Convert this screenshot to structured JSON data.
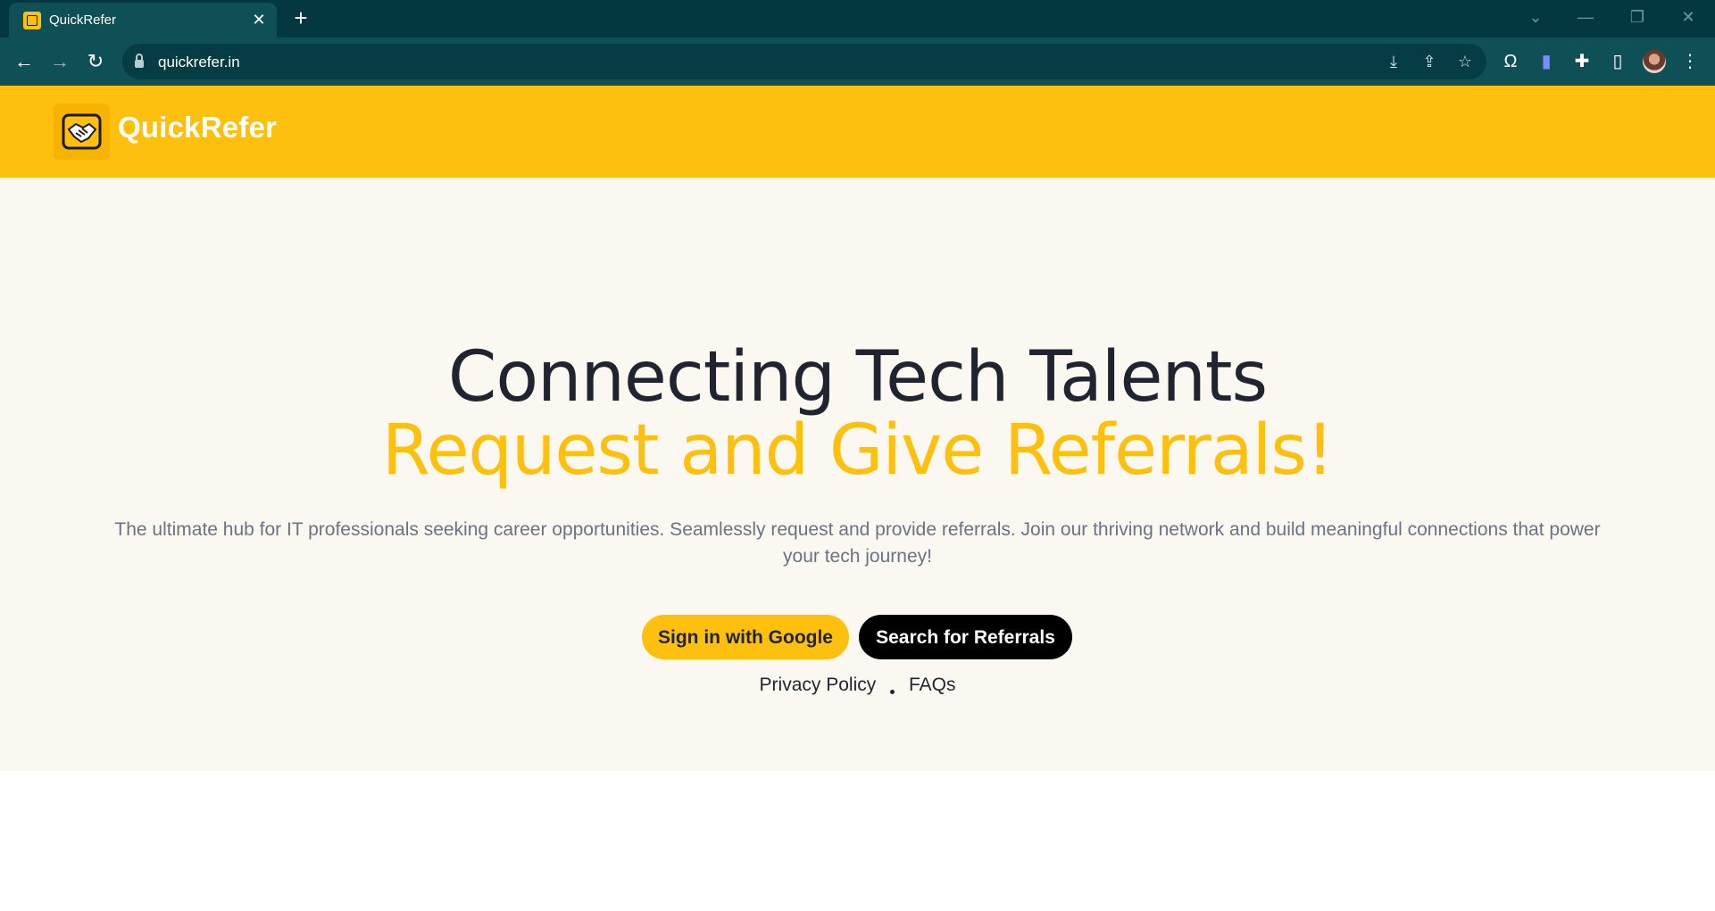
{
  "browser": {
    "tab_title": "QuickRefer",
    "tab_close": "✕",
    "new_tab": "+",
    "url": "quickrefer.in",
    "icons": {
      "back": "←",
      "forward": "→",
      "reload": "↻",
      "install": "⤓",
      "share": "⇪",
      "bookmark": "☆",
      "ext1": "Ω",
      "ext2": "🔖",
      "extensions": "✚",
      "side_panel": "▯",
      "menu": "⋮",
      "tab_search": "⌄",
      "minimize": "—",
      "restore": "❐",
      "close": "✕"
    },
    "colors": {
      "tabstrip": "#043841",
      "toolbar": "#0f5057"
    }
  },
  "header": {
    "brand": "QuickRefer",
    "logo_icon": "handshake-icon",
    "color": "#fdc00f"
  },
  "hero": {
    "headline": "Connecting Tech Talents",
    "subheadline": "Request and Give Referrals!",
    "description": "The ultimate hub for IT professionals seeking career opportunities. Seamlessly request and provide referrals. Join our thriving network and build meaningful connections that power your tech journey!",
    "primary_button": "Sign in with Google",
    "secondary_button": "Search for Referrals",
    "links": {
      "privacy": "Privacy Policy",
      "faqs": "FAQs"
    }
  }
}
